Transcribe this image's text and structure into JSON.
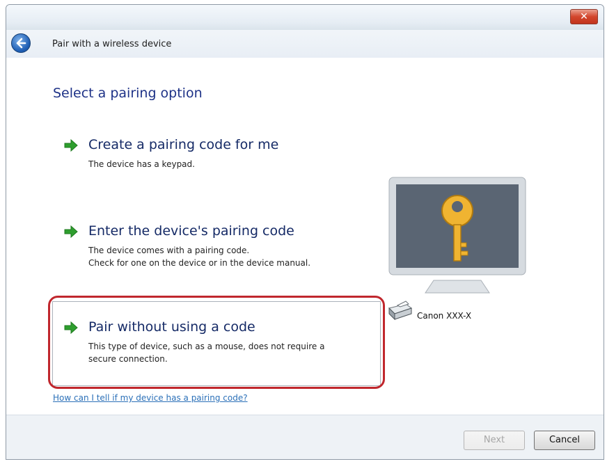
{
  "window": {
    "close_label": "✕",
    "title": "Pair with a wireless device"
  },
  "heading": "Select a pairing option",
  "options": [
    {
      "title": "Create a pairing code for me",
      "description": [
        "The device has a keypad."
      ]
    },
    {
      "title": "Enter the device's pairing code",
      "description": [
        "The device comes with a pairing code.",
        "Check for one on the device or in the device manual."
      ]
    },
    {
      "title": "Pair without using a code",
      "description": [
        "This type of device, such as a mouse, does not require a",
        "secure connection."
      ],
      "selected": true
    }
  ],
  "help_link": "How can I tell if my device has a pairing code?",
  "device": {
    "label": "Canon XXX-X",
    "monitor_icon": "key-icon",
    "printer_icon": "printer-icon"
  },
  "buttons": {
    "next": "Next",
    "cancel": "Cancel"
  },
  "colors": {
    "highlight": "#c0272d",
    "link": "#2b70b8",
    "heading": "#1e3287",
    "arrow": "#2e9e2e"
  }
}
